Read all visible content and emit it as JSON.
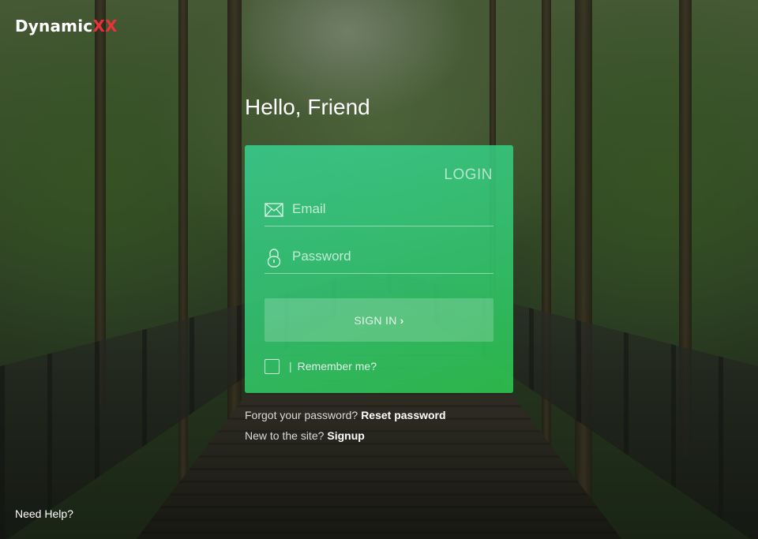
{
  "brand": {
    "name_main": "Dynamic",
    "name_accent": "XX",
    "accent_color": "#e8323a"
  },
  "greeting": "Hello, Friend",
  "login_card": {
    "title": "LOGIN",
    "email": {
      "placeholder": "Email",
      "value": "",
      "icon": "envelope-icon"
    },
    "password": {
      "placeholder": "Password",
      "value": "",
      "icon": "lock-icon"
    },
    "submit_label": "SIGN IN",
    "submit_icon": "chevron-right-icon",
    "remember_separator": "|",
    "remember_label": "Remember me?",
    "remember_checked": false,
    "gradient_colors": [
      "#38d696",
      "#2cc44e"
    ]
  },
  "links": {
    "forgot_text": "Forgot your password?",
    "reset_link": "Reset password",
    "new_text": "New to the site?",
    "signup_link": "Signup",
    "need_help": "Need Help?"
  }
}
